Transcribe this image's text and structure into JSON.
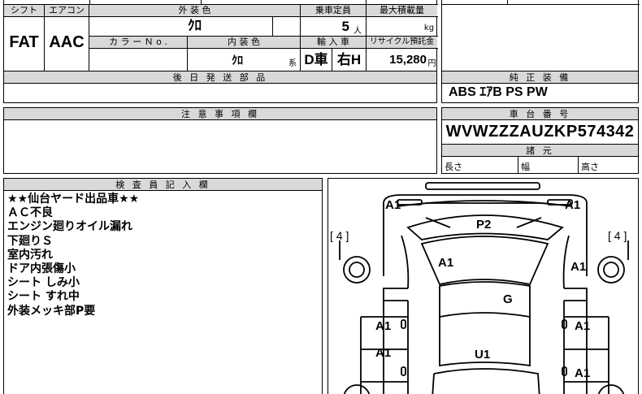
{
  "vehicle": {
    "shift_label": "シフト",
    "shift_value": "FAT",
    "aircon_label": "エアコン",
    "aircon_value": "AAC",
    "ext_color_label": "外 装 色",
    "ext_color_value": "ｸﾛ",
    "color_no_label": "カ ラ ー Ｎ o .",
    "color_no_value": "",
    "int_color_label": "内 装 色",
    "int_color_value": "ｸﾛ",
    "int_color_suffix": "系",
    "capacity_label": "乗車定員",
    "capacity_value": "5",
    "capacity_unit": "人",
    "load_label": "最大積載量",
    "load_value": "",
    "load_unit": "kg",
    "import_label": "輸 入 車",
    "import_dealer": "D車",
    "import_handle": "右H",
    "recycle_label": "リサイクル預託金",
    "recycle_value": "15,280",
    "recycle_unit": "円"
  },
  "later_parts": {
    "label": "後 日 発 送 部 品",
    "value": ""
  },
  "genuine": {
    "label": "純 正 装 備",
    "value": "ABS ｴｱB PS PW"
  },
  "notes": {
    "label": "注 意 事 項 欄",
    "value": ""
  },
  "chassis": {
    "label": "車 台 番 号",
    "value": "WVWZZZAUZKP574342",
    "specs_label": "諸 元",
    "length_label": "長さ",
    "width_label": "幅",
    "height_label": "高さ"
  },
  "inspector": {
    "label": "検 査 員 記 入 欄",
    "lines": [
      "★★仙台ヤード出品車★★",
      "ＡＣ不良",
      "エンジン廻りオイル漏れ",
      "下廻りＳ",
      "室内汚れ",
      "ドア内張傷小",
      "シート しみ小",
      "シート すれ中",
      "外装メッキ部P要"
    ]
  },
  "diagram": {
    "left_bracket": "[ 4 ]",
    "right_bracket": "[ 4 ]",
    "marks": {
      "front_left": "A1",
      "front_right": "A1",
      "hood": "P2",
      "windshield": "A1",
      "front_fender_right": "A1",
      "roof": "G",
      "front_door_left": "A1",
      "front_door_right": "A1",
      "rear_door_left": "A1",
      "rear_door_right": "A1",
      "trunk": "U1"
    }
  }
}
